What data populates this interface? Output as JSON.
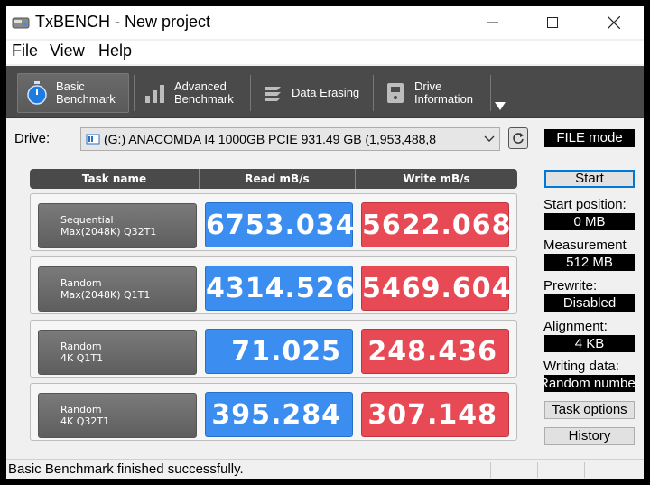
{
  "window": {
    "title": "TxBENCH - New project"
  },
  "menu": {
    "file": "File",
    "view": "View",
    "help": "Help"
  },
  "toolbar": {
    "tabs": [
      {
        "line1": "Basic",
        "line2": "Benchmark",
        "icon": "stopwatch-icon",
        "active": true
      },
      {
        "line1": "Advanced",
        "line2": "Benchmark",
        "icon": "bar-chart-icon",
        "active": false
      },
      {
        "line1": "Data Erasing",
        "line2": "",
        "icon": "erase-icon",
        "active": false
      },
      {
        "line1": "Drive",
        "line2": "Information",
        "icon": "drive-info-icon",
        "active": false
      }
    ]
  },
  "drive": {
    "label": "Drive:",
    "selected": "(G:) ANACOMDA I4 1000GB PCIE   931.49 GB (1,953,488,8"
  },
  "table": {
    "headers": {
      "task": "Task name",
      "read": "Read mB/s",
      "write": "Write mB/s"
    },
    "rows": [
      {
        "line1": "Sequential",
        "line2": "Max(2048K) Q32T1",
        "read": "6753.034",
        "write": "5622.068"
      },
      {
        "line1": "Random",
        "line2": "Max(2048K) Q1T1",
        "read": "4314.526",
        "write": "5469.604"
      },
      {
        "line1": "Random",
        "line2": "4K Q1T1",
        "read": "71.025",
        "write": "248.436"
      },
      {
        "line1": "Random",
        "line2": "4K Q32T1",
        "read": "395.284",
        "write": "307.148"
      }
    ]
  },
  "side": {
    "mode": "FILE mode",
    "start": "Start",
    "start_position_label": "Start position:",
    "start_position_value": "0 MB",
    "measurement_label": "Measurement",
    "measurement_value": "512 MB",
    "prewrite_label": "Prewrite:",
    "prewrite_value": "Disabled",
    "alignment_label": "Alignment:",
    "alignment_value": "4 KB",
    "writing_data_label": "Writing data:",
    "writing_data_value": "Random number",
    "task_options": "Task options",
    "history": "History"
  },
  "status": {
    "message": "Basic Benchmark finished successfully."
  },
  "colors": {
    "read": "#3c8df0",
    "write": "#e84a55",
    "toolbar": "#4a4a4a"
  }
}
